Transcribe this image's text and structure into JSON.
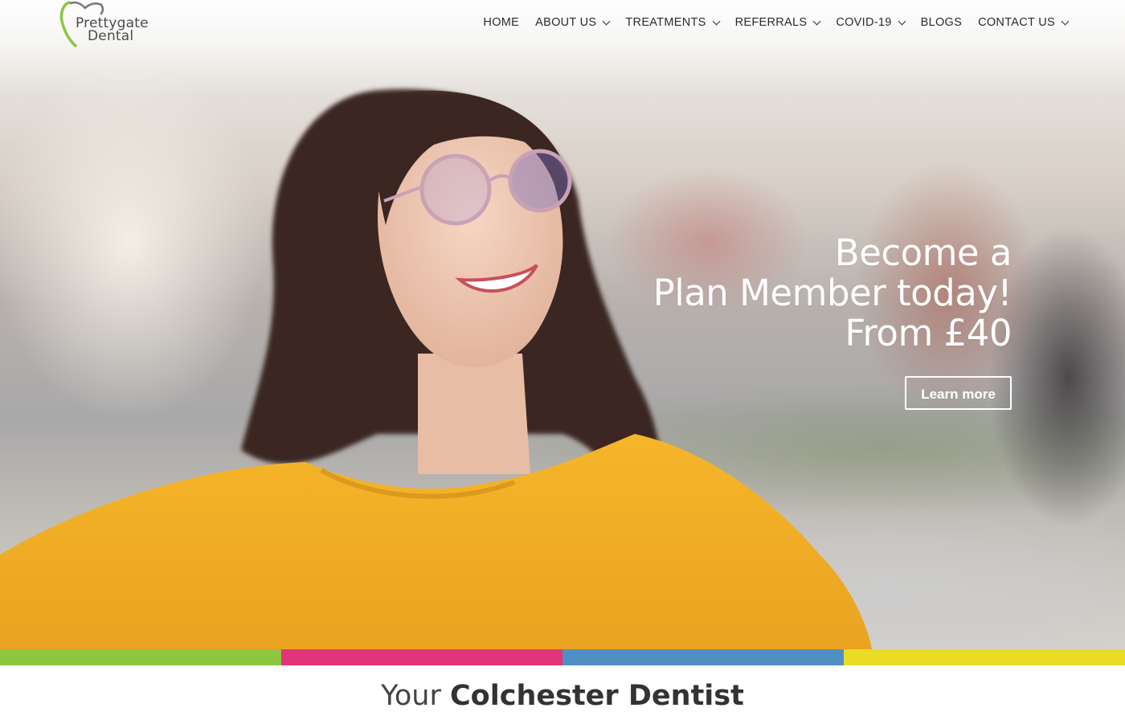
{
  "brand": {
    "name_line1": "Prettygate",
    "name_line2": "Dental",
    "logo_green": "#8cc63f",
    "logo_grey": "#7a7a7a"
  },
  "nav": {
    "items": [
      {
        "label": "HOME",
        "dropdown": false
      },
      {
        "label": "ABOUT US",
        "dropdown": true
      },
      {
        "label": "TREATMENTS",
        "dropdown": true
      },
      {
        "label": "REFERRALS",
        "dropdown": true
      },
      {
        "label": "COVID-19",
        "dropdown": true
      },
      {
        "label": "BLOGS",
        "dropdown": false
      },
      {
        "label": "CONTACT US",
        "dropdown": true
      }
    ]
  },
  "hero": {
    "headline_lines": [
      "Become a",
      "Plan Member today!",
      "From £40"
    ],
    "button_label": "Learn more"
  },
  "stripe_colors": [
    "#8dc63f",
    "#e0357a",
    "#4f8fc4",
    "#e8dc25"
  ],
  "section": {
    "title_light": "Your",
    "title_bold": "Colchester Dentist"
  }
}
